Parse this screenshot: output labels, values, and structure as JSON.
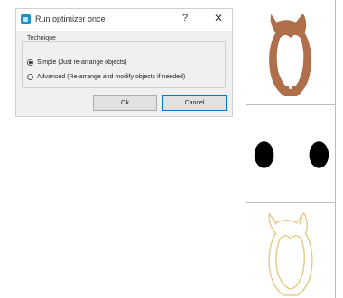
{
  "dialog": {
    "title": "Run optimizer once",
    "help_glyph": "?",
    "close_glyph": "✕",
    "group_label": "Technique",
    "options": [
      {
        "label": "Simple (Just re-arrange objects)",
        "selected": true
      },
      {
        "label": "Advanced (Re-arrange and modify objects if needed)",
        "selected": false
      }
    ],
    "ok_label": "Ok",
    "cancel_label": "Cancel"
  },
  "panels": [
    {
      "kind": "owl-filled",
      "color": "#b06f4b"
    },
    {
      "kind": "two-dots",
      "color": "#000000"
    },
    {
      "kind": "owl-outline",
      "color": "#e5c983"
    }
  ],
  "colors": {
    "accent": "#0078d7",
    "dialog_bg": "#f0f0f0"
  }
}
